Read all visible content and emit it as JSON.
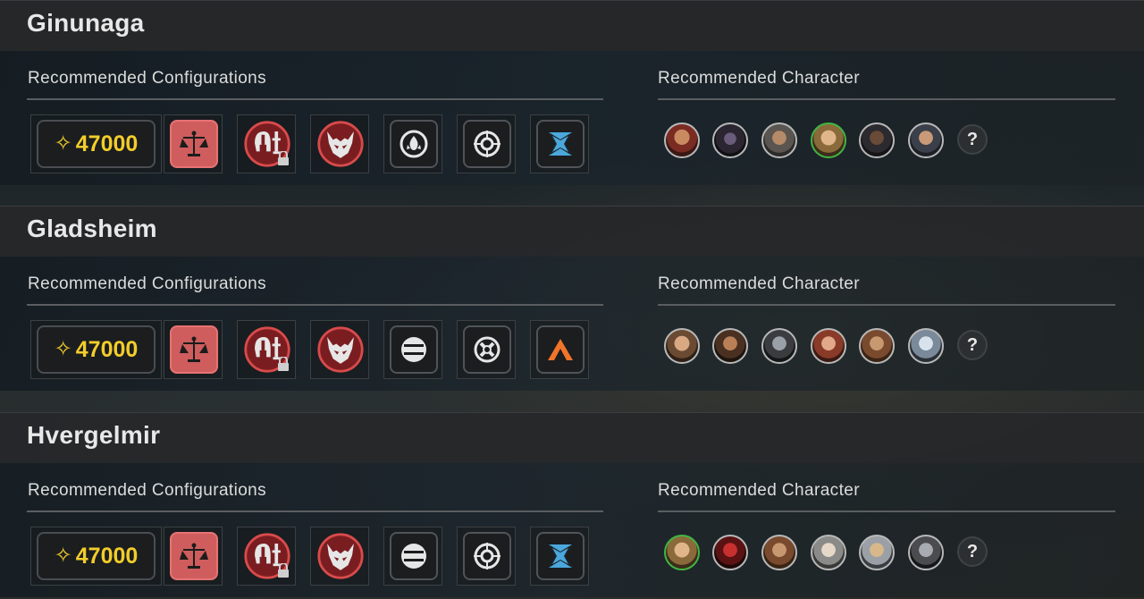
{
  "sections": [
    {
      "title": "Ginunaga",
      "config_label": "Recommended Configurations",
      "character_label": "Recommended Character",
      "cost_symbol": "✧",
      "cost": "47000",
      "configs": [
        "balance-scale-icon",
        "helmet-syringe-locked-icon",
        "horned-mask-icon",
        "flame-drop-icon",
        "crosshair-icon",
        "blue-shuriken-icon"
      ],
      "unknown_label": "?"
    },
    {
      "title": "Gladsheim",
      "config_label": "Recommended Configurations",
      "character_label": "Recommended Character",
      "cost_symbol": "✧",
      "cost": "47000",
      "configs": [
        "balance-scale-icon",
        "helmet-syringe-locked-icon",
        "horned-mask-icon",
        "split-circle-icon",
        "x-circle-icon",
        "orange-chevron-icon"
      ],
      "unknown_label": "?"
    },
    {
      "title": "Hvergelmir",
      "config_label": "Recommended Configurations",
      "character_label": "Recommended Character",
      "cost_symbol": "✧",
      "cost": "47000",
      "configs": [
        "balance-scale-icon",
        "helmet-syringe-locked-icon",
        "horned-mask-icon",
        "split-circle-icon",
        "crosshair-icon",
        "blue-shuriken-icon"
      ],
      "unknown_label": "?"
    }
  ],
  "colors": {
    "accent_gold": "#f2cd2a",
    "scale_red": "#cf5d5d",
    "mask_red": "#8b1f22",
    "selected_green": "#42b542",
    "shuriken_blue": "#4aa8dc",
    "chevron_orange": "#f0742a"
  }
}
